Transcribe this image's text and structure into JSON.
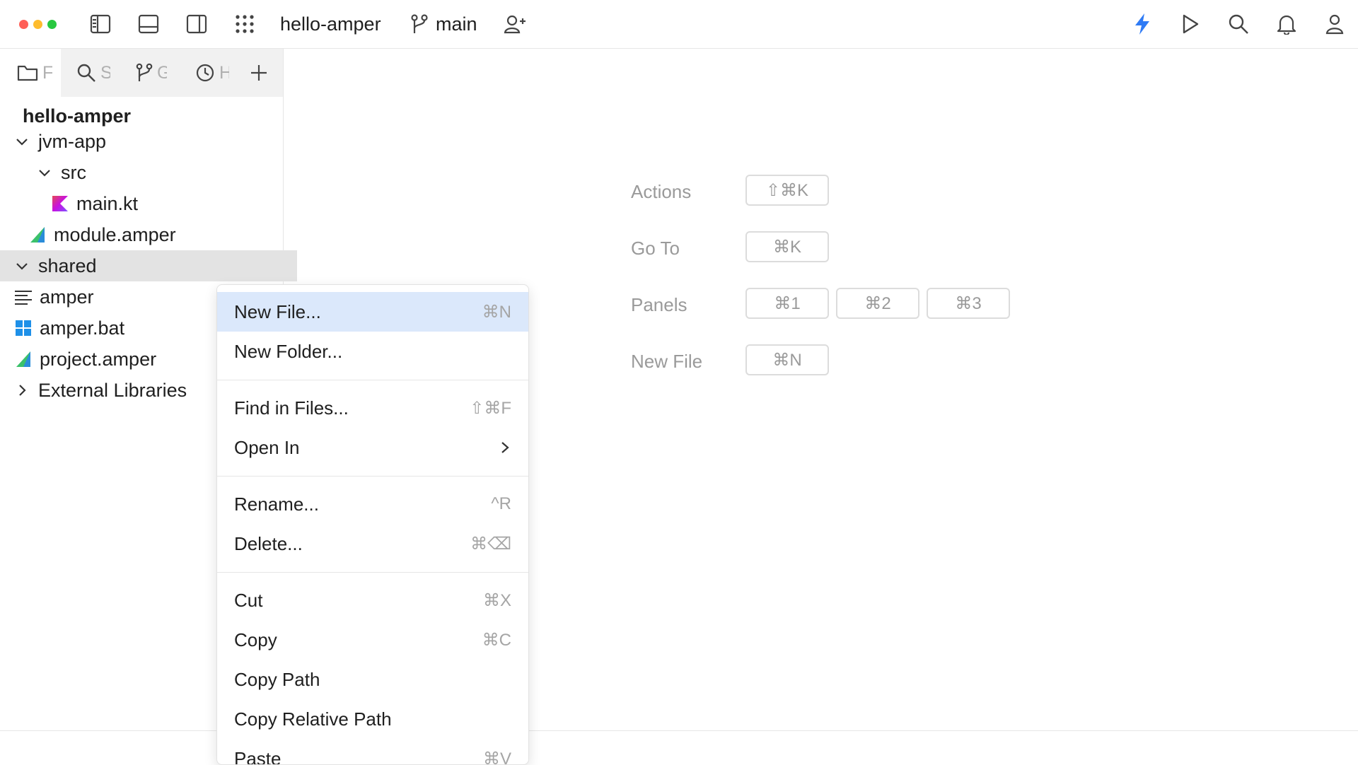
{
  "titlebar": {
    "project": "hello-amper",
    "branch": "main",
    "colors": {
      "close": "#ff5f57",
      "minimize": "#febc2e",
      "zoom": "#28c840",
      "accent": "#2f7bf5"
    },
    "icons": [
      "toggle-left-panel-icon",
      "toggle-bottom-panel-icon",
      "toggle-right-panel-icon",
      "apps-grid-icon",
      "branch-icon",
      "add-user-icon",
      "lightning-icon",
      "run-icon",
      "search-icon",
      "bell-icon",
      "user-icon"
    ]
  },
  "tooltabs": [
    {
      "name": "files",
      "label": "F",
      "icon": "folder-icon"
    },
    {
      "name": "search",
      "label": "S",
      "icon": "search-icon"
    },
    {
      "name": "git",
      "label": "G",
      "icon": "branch-icon"
    },
    {
      "name": "history",
      "label": "H",
      "icon": "clock-icon"
    }
  ],
  "tree": {
    "project": "hello-amper",
    "rows": [
      {
        "label": "jvm-app",
        "indent": 0,
        "expander": "open",
        "icon": ""
      },
      {
        "label": "src",
        "indent": 1,
        "expander": "open",
        "icon": ""
      },
      {
        "label": "main.kt",
        "indent": 2,
        "expander": "",
        "icon": "kotlin-file-icon"
      },
      {
        "label": "module.amper",
        "indent": 1,
        "expander": "",
        "icon": "amper-file-icon"
      },
      {
        "label": "shared",
        "indent": 0,
        "expander": "open",
        "icon": "",
        "selected": true
      },
      {
        "label": "amper",
        "indent": 0,
        "expander": "",
        "icon": "text-file-icon"
      },
      {
        "label": "amper.bat",
        "indent": 0,
        "expander": "",
        "icon": "windows-file-icon"
      },
      {
        "label": "project.amper",
        "indent": 0,
        "expander": "",
        "icon": "amper-file-icon"
      },
      {
        "label": "External Libraries",
        "indent": 0,
        "expander": "closed",
        "icon": ""
      }
    ]
  },
  "welcome": [
    {
      "label": "Actions",
      "keys": [
        "⇧⌘K"
      ]
    },
    {
      "label": "Go To",
      "keys": [
        "⌘K"
      ]
    },
    {
      "label": "Panels",
      "keys": [
        "⌘1",
        "⌘2",
        "⌘3"
      ]
    },
    {
      "label": "New File",
      "keys": [
        "⌘N"
      ]
    }
  ],
  "context_menu": {
    "items": [
      {
        "label": "New File...",
        "shortcut": "⌘N",
        "highlighted": true
      },
      {
        "label": "New Folder...",
        "shortcut": ""
      },
      {
        "separator": true
      },
      {
        "label": "Find in Files...",
        "shortcut": "⇧⌘F"
      },
      {
        "label": "Open In",
        "submenu": true,
        "shortcut": ""
      },
      {
        "separator": true
      },
      {
        "label": "Rename...",
        "shortcut": "^R"
      },
      {
        "label": "Delete...",
        "shortcut": "⌘⌫"
      },
      {
        "separator": true
      },
      {
        "label": "Cut",
        "shortcut": "⌘X"
      },
      {
        "label": "Copy",
        "shortcut": "⌘C"
      },
      {
        "label": "Copy Path",
        "shortcut": ""
      },
      {
        "label": "Copy Relative Path",
        "shortcut": ""
      },
      {
        "label": "Paste",
        "shortcut": "⌘V"
      }
    ]
  }
}
